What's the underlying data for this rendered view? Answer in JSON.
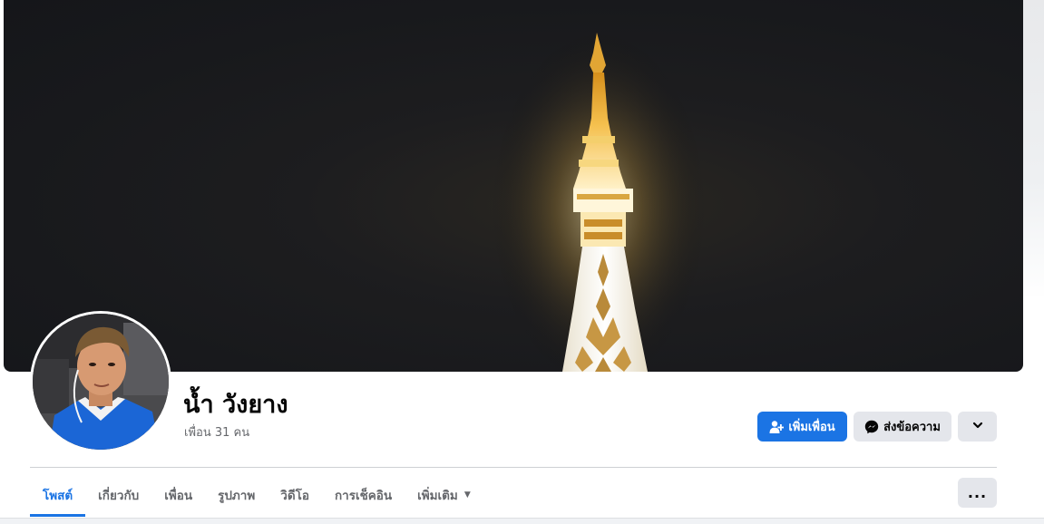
{
  "profile": {
    "name": "น้ำ วังยาง",
    "friends_count": "เพื่อน 31 คน"
  },
  "actions": {
    "add_friend_label": "เพิ่มเพื่อน",
    "add_friend_icon": "add-friend-icon",
    "message_label": "ส่งข้อความ",
    "message_icon": "messenger-icon",
    "more_icon": "chevron-down-icon"
  },
  "tabs": [
    {
      "label": "โพสต์",
      "active": true
    },
    {
      "label": "เกี่ยวกับ",
      "active": false
    },
    {
      "label": "เพื่อน",
      "active": false
    },
    {
      "label": "รูปภาพ",
      "active": false
    },
    {
      "label": "วิดีโอ",
      "active": false
    },
    {
      "label": "การเช็คอิน",
      "active": false
    },
    {
      "label": "เพิ่มเติม",
      "active": false,
      "has_dropdown": true
    }
  ],
  "tab_more_options": "...",
  "colors": {
    "accent": "#1b74e4",
    "secondary_button": "#e4e6eb",
    "text_primary": "#050505",
    "text_secondary": "#65676b"
  }
}
